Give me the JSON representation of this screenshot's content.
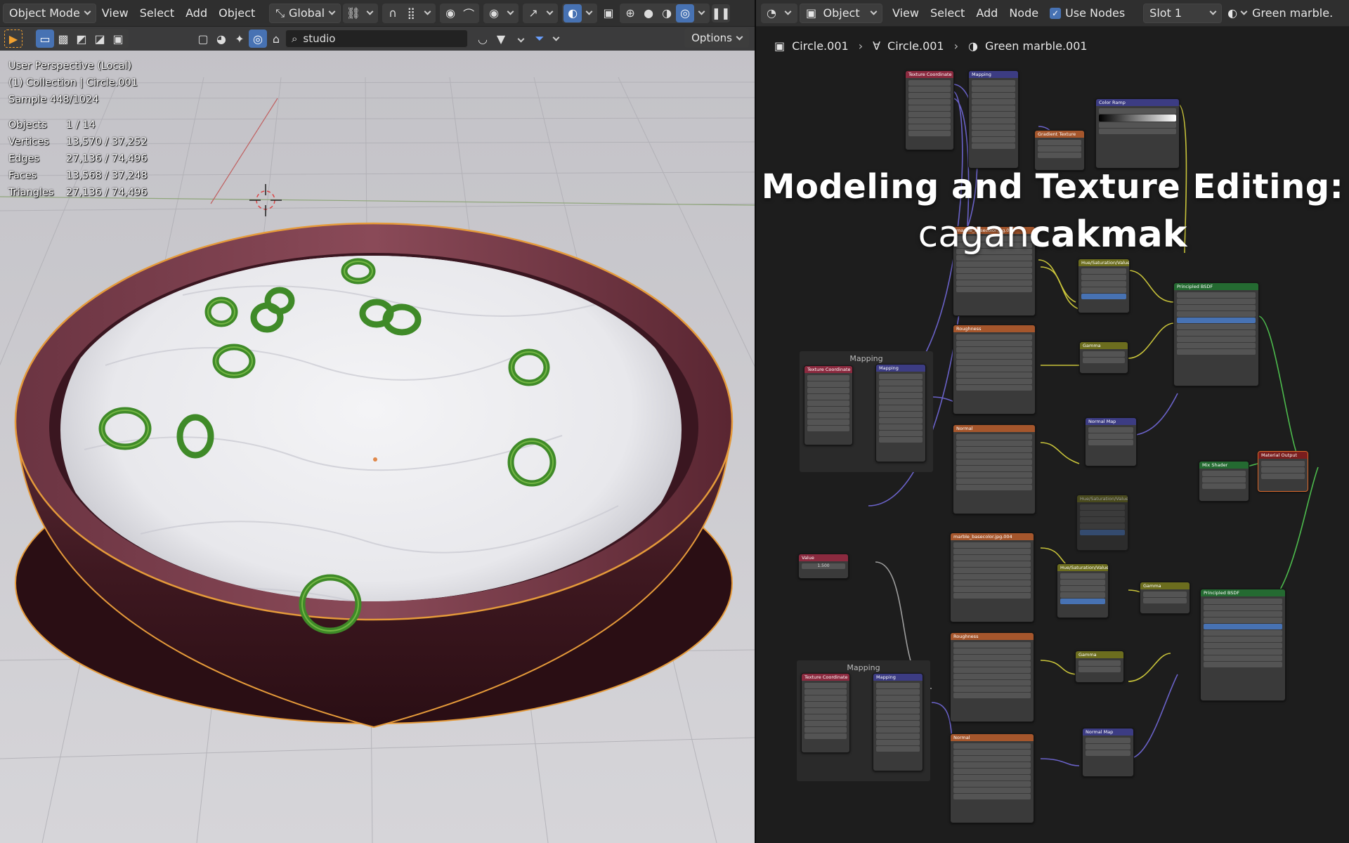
{
  "viewport": {
    "mode_label": "Object Mode",
    "menu": [
      "View",
      "Select",
      "Add",
      "Object"
    ],
    "transform_orientation": "Global",
    "search_value": "studio",
    "options_label": "Options",
    "overlay_lines": [
      "User Perspective (Local)",
      "(1) Collection | Circle.001",
      "Sample 448/1024"
    ],
    "stats": [
      {
        "key": "Objects",
        "value": "1 / 14"
      },
      {
        "key": "Vertices",
        "value": "13,570 / 37,252"
      },
      {
        "key": "Edges",
        "value": "27,136 / 74,496"
      },
      {
        "key": "Faces",
        "value": "13,568 / 37,248"
      },
      {
        "key": "Triangles",
        "value": "27,136 / 74,496"
      }
    ]
  },
  "node_editor": {
    "object_mode_label": "Object",
    "menu": [
      "View",
      "Select",
      "Add",
      "Node"
    ],
    "use_nodes_label": "Use Nodes",
    "slot_label": "Slot 1",
    "material_label": "Green marble.",
    "breadcrumb": [
      "Circle.001",
      "Circle.001",
      "Green marble.001"
    ],
    "title": "Modeling and Texture Editing:",
    "author_light": "cagan",
    "author_bold": "cakmak",
    "frames": [
      "Mapping",
      "Mapping"
    ],
    "node_titles": {
      "tex_coord": "Texture Coordinate",
      "mapping": "Mapping",
      "gradient": "Gradient Texture",
      "color_ramp": "Color Ramp",
      "hue_sat": "Hue/Saturation/Value",
      "principled": "Principled BSDF",
      "roughness": "Roughness",
      "gamma": "Gamma",
      "normal": "Normal",
      "normal_map": "Normal Map",
      "mix_shader": "Mix Shader",
      "material_output": "Material Output",
      "value": "Value",
      "basecolor": "marble_basecolor.jpg.004"
    },
    "value_node_value": "1.500"
  },
  "colors": {
    "accent_blue": "#4772b3",
    "texture_header": "#a5562c",
    "input_header": "#8b2a3f",
    "vector_header": "#3c3c83",
    "color_header": "#6c6d1e",
    "shader_header": "#246a31",
    "output_header": "#7a1e1e"
  }
}
